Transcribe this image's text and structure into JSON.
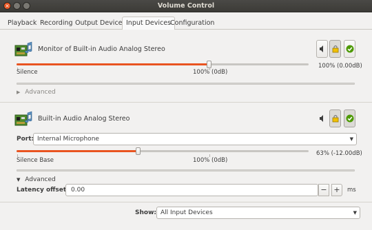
{
  "window": {
    "title": "Volume Control"
  },
  "tabs": [
    {
      "label": "Playback"
    },
    {
      "label": "Recording"
    },
    {
      "label": "Output Devices"
    },
    {
      "label": "Input Devices"
    },
    {
      "label": "Configuration"
    }
  ],
  "devices": [
    {
      "name": "Monitor of Built-in Audio Analog Stereo",
      "volume_readout": "100% (0.00dB)",
      "volume_fraction": 0.73,
      "scale_left": "Silence",
      "scale_mid": "100% (0dB)",
      "advanced_label": "Advanced"
    },
    {
      "name": "Built-in Audio Analog Stereo",
      "port_label": "Port:",
      "port_value": "Internal Microphone",
      "volume_readout": "63% (-12.00dB)",
      "volume_fraction": 0.35,
      "scale_left": "Silence Base",
      "scale_mid": "100% (0dB)",
      "advanced_label": "Advanced",
      "latency_label": "Latency offset:",
      "latency_value": "0.00",
      "latency_unit": "ms",
      "minus": "−",
      "plus": "+"
    }
  ],
  "footer": {
    "show_label": "Show:",
    "show_value": "All Input Devices"
  },
  "colors": {
    "accent": "#e95420",
    "titlebar": "#3c3b37",
    "lock_icon": "#f0c000",
    "check_icon": "#4e9a06"
  },
  "icons": [
    "close-icon",
    "minimize-icon",
    "maximize-icon",
    "sound-card-icon",
    "speaker-icon",
    "lock-icon",
    "check-icon",
    "triangle-right-icon",
    "triangle-down-icon",
    "dropdown-arrow-icon"
  ]
}
